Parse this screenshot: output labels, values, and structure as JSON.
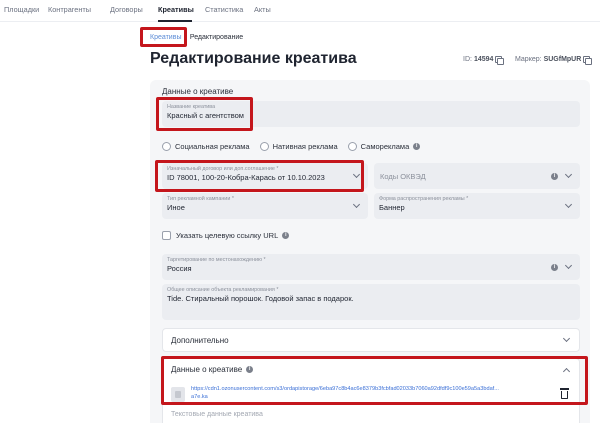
{
  "nav": {
    "tabs": [
      {
        "label": "Площадки"
      },
      {
        "label": "Контрагенты"
      },
      {
        "label": "Договоры"
      },
      {
        "label": "Креативы"
      },
      {
        "label": "Статистика"
      },
      {
        "label": "Акты"
      }
    ],
    "active_tab": "Креативы"
  },
  "breadcrumb": {
    "parent": "Креативы",
    "separator": "›",
    "current": "Редактирование"
  },
  "page_title": "Редактирование креатива",
  "meta": {
    "id_label": "ID:",
    "id_value": "14594",
    "marker_label": "Маркер:",
    "marker_value": "SUGfMpUR"
  },
  "section_title": "Данные о креативе",
  "creative_name": {
    "label": "Название креатива",
    "value": "Красный с агентством"
  },
  "ad_types": [
    {
      "label": "Социальная реклама"
    },
    {
      "label": "Нативная реклама"
    },
    {
      "label": "Самореклама"
    }
  ],
  "contract": {
    "label": "Изначальный договор или доп.соглашение *",
    "value": "ID 78001, 100-20-Кобра-Карась от 10.10.2023"
  },
  "okved": {
    "placeholder": "Коды ОКВЭД"
  },
  "campaign_type": {
    "label": "Тип рекламной кампании *",
    "value": "Иное"
  },
  "distribution_form": {
    "label": "Форма распространения рекламы *",
    "value": "Баннер"
  },
  "target_url_checkbox": {
    "label": "Указать целевую ссылку URL"
  },
  "location": {
    "label": "Таргетирование по местонахождению *",
    "value": "Россия"
  },
  "description": {
    "label": "Общее описание объекта рекламирования *",
    "value": "Tide. Стиральный порошок. Годовой запас в подарок."
  },
  "additional_panel": {
    "title": "Дополнительно"
  },
  "creative_data_panel": {
    "title": "Данные о креативе",
    "file_url": "https://cdn1.ozonusercontent.com/s3/ordapistorage/6eba97c8b4ac6e8379b3fcbfad02033b7060a92dfdf9c100e59a5a3bdaf...",
    "file_url_tail": "a7e.ka",
    "text_data_placeholder": "Текстовые данные креатива"
  },
  "colors": {
    "accent": "#3a6fd6",
    "highlight": "#c4161c",
    "field_bg": "#ebedf1",
    "card_bg": "#f5f6f8"
  }
}
